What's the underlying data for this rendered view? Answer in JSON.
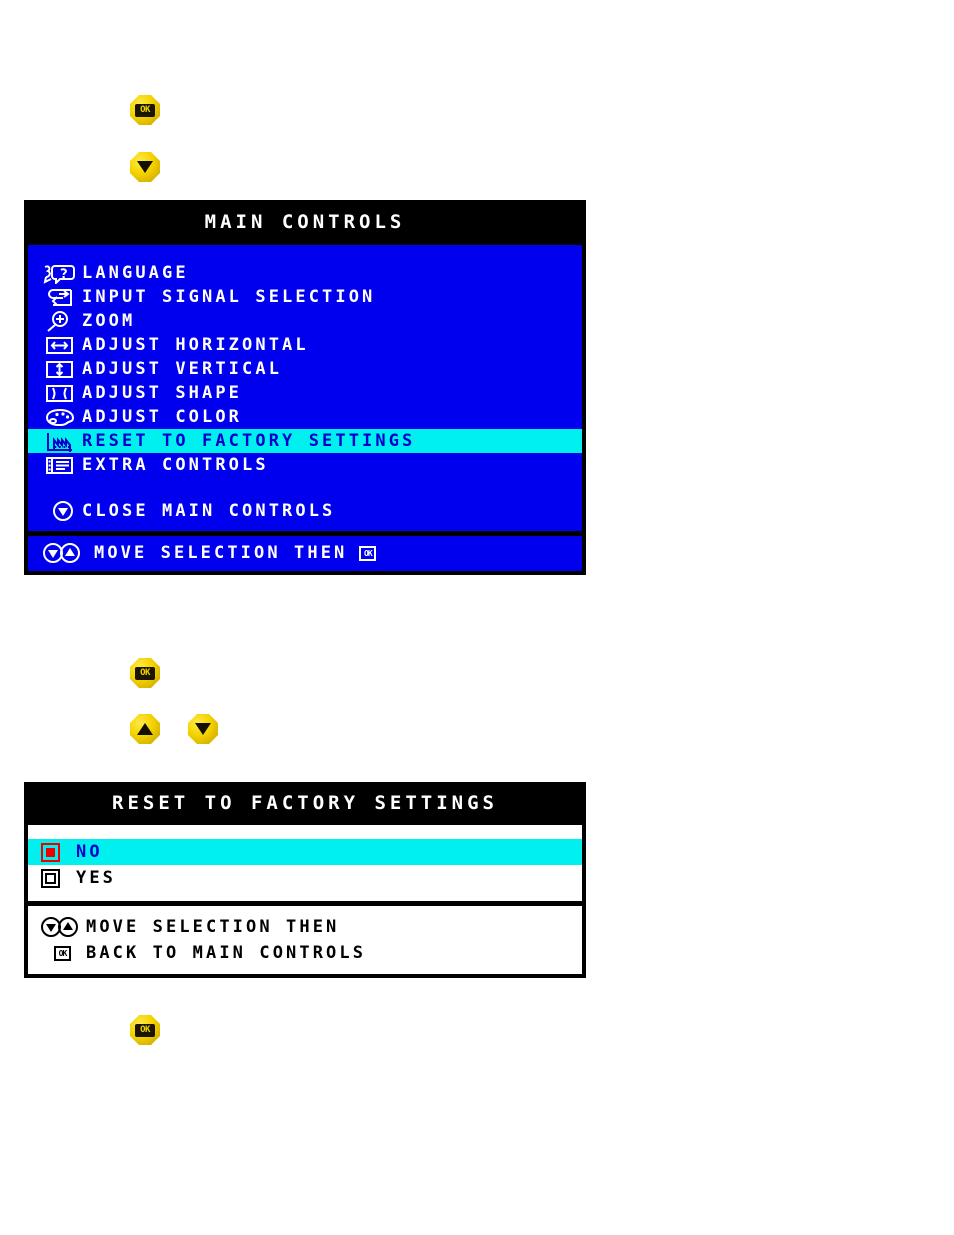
{
  "buttons": {
    "ok_label": "OK",
    "ok_name": "ok-button",
    "down_name": "down-arrow-button",
    "up_name": "up-arrow-button"
  },
  "main_controls": {
    "title": "MAIN CONTROLS",
    "items": [
      {
        "icon": "language-icon",
        "label": "LANGUAGE",
        "selected": false
      },
      {
        "icon": "input-signal-icon",
        "label": "INPUT SIGNAL SELECTION",
        "selected": false
      },
      {
        "icon": "zoom-icon",
        "label": "ZOOM",
        "selected": false
      },
      {
        "icon": "adjust-horizontal-icon",
        "label": "ADJUST HORIZONTAL",
        "selected": false
      },
      {
        "icon": "adjust-vertical-icon",
        "label": "ADJUST VERTICAL",
        "selected": false
      },
      {
        "icon": "adjust-shape-icon",
        "label": "ADJUST SHAPE",
        "selected": false
      },
      {
        "icon": "adjust-color-icon",
        "label": "ADJUST COLOR",
        "selected": false
      },
      {
        "icon": "factory-reset-icon",
        "label": "RESET TO FACTORY SETTINGS",
        "selected": true
      },
      {
        "icon": "extra-controls-icon",
        "label": "EXTRA CONTROLS",
        "selected": false
      }
    ],
    "close_item": {
      "icon": "down-arrow-circle-icon",
      "label": "CLOSE MAIN CONTROLS"
    },
    "footer": {
      "icon": "updown-arrow-circle-icon",
      "label": "MOVE SELECTION THEN",
      "trailing_icon": "ok-box-icon",
      "trailing_label": "OK"
    }
  },
  "reset_dialog": {
    "title": "RESET TO FACTORY SETTINGS",
    "options": [
      {
        "icon": "radio-selected-icon",
        "label": "NO",
        "selected": true
      },
      {
        "icon": "radio-unselected-icon",
        "label": "YES",
        "selected": false
      }
    ],
    "footer_lines": [
      {
        "icon": "updown-arrow-circle-icon",
        "label": "MOVE SELECTION THEN"
      },
      {
        "icon": "ok-box-icon",
        "label": "BACK TO MAIN CONTROLS"
      }
    ]
  },
  "colors": {
    "osd_blue": "#0000ee",
    "highlight_cyan": "#00f0f0",
    "highlight_text": "#0000cc",
    "title_black": "#000000",
    "text_white": "#ffffff",
    "button_yellow": "#f5d400",
    "radio_red": "#ee0000"
  }
}
